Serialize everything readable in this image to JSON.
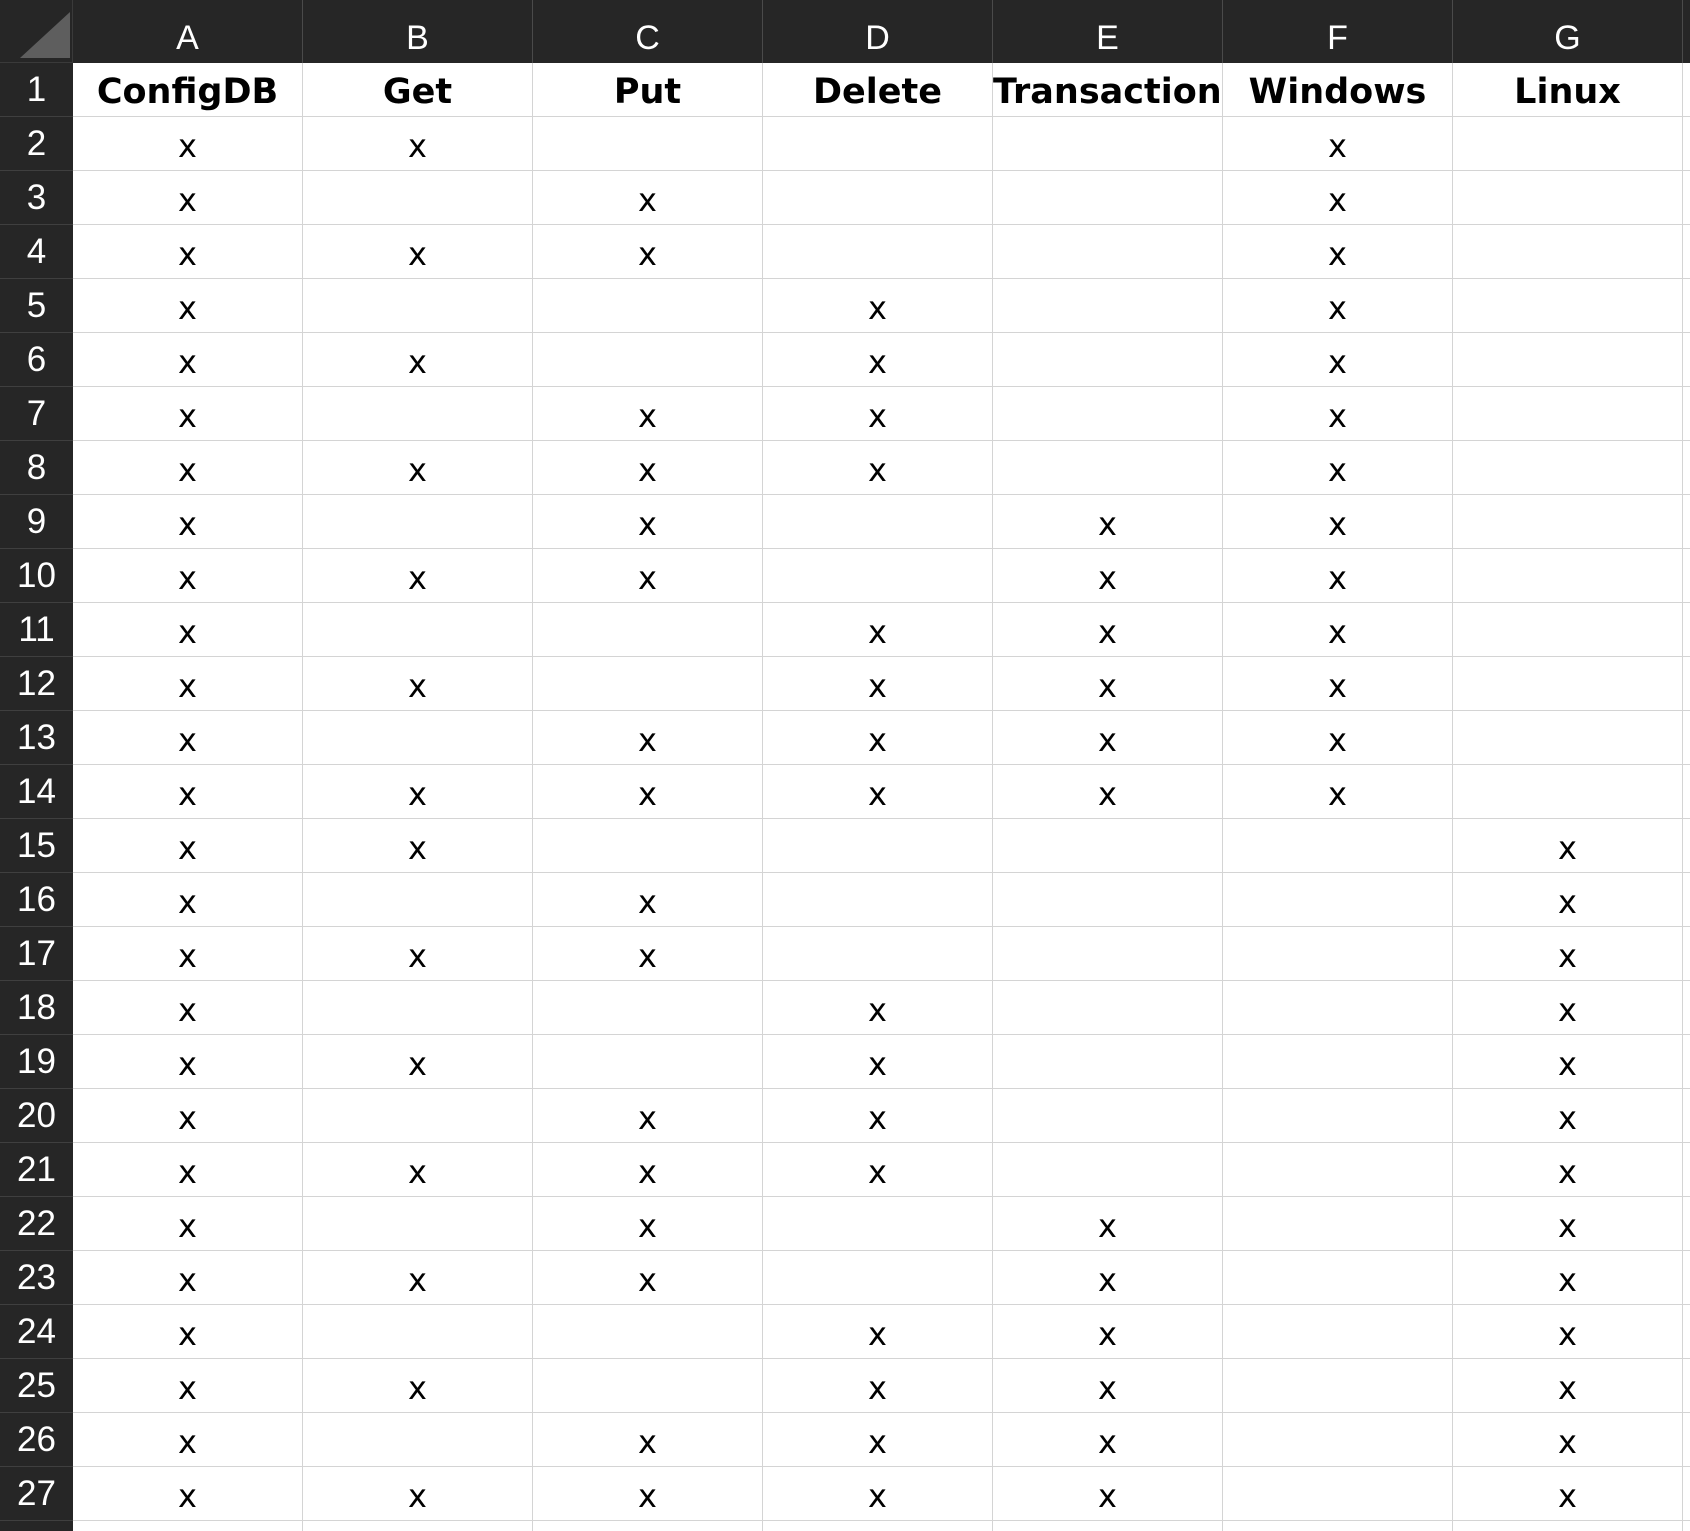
{
  "spreadsheet": {
    "column_letters": [
      "A",
      "B",
      "C",
      "D",
      "E",
      "F",
      "G"
    ],
    "row_numbers": [
      "1",
      "2",
      "3",
      "4",
      "5",
      "6",
      "7",
      "8",
      "9",
      "10",
      "11",
      "12",
      "13",
      "14",
      "15",
      "16",
      "17",
      "18",
      "19",
      "20",
      "21",
      "22",
      "23",
      "24",
      "25",
      "26",
      "27"
    ],
    "header_row": [
      "ConfigDB",
      "Get",
      "Put",
      "Delete",
      "Transactions",
      "Windows",
      "Linux"
    ],
    "rows": [
      [
        "x",
        "x",
        "",
        "",
        "",
        "x",
        ""
      ],
      [
        "x",
        "",
        "x",
        "",
        "",
        "x",
        ""
      ],
      [
        "x",
        "x",
        "x",
        "",
        "",
        "x",
        ""
      ],
      [
        "x",
        "",
        "",
        "x",
        "",
        "x",
        ""
      ],
      [
        "x",
        "x",
        "",
        "x",
        "",
        "x",
        ""
      ],
      [
        "x",
        "",
        "x",
        "x",
        "",
        "x",
        ""
      ],
      [
        "x",
        "x",
        "x",
        "x",
        "",
        "x",
        ""
      ],
      [
        "x",
        "",
        "x",
        "",
        "x",
        "x",
        ""
      ],
      [
        "x",
        "x",
        "x",
        "",
        "x",
        "x",
        ""
      ],
      [
        "x",
        "",
        "",
        "x",
        "x",
        "x",
        ""
      ],
      [
        "x",
        "x",
        "",
        "x",
        "x",
        "x",
        ""
      ],
      [
        "x",
        "",
        "x",
        "x",
        "x",
        "x",
        ""
      ],
      [
        "x",
        "x",
        "x",
        "x",
        "x",
        "x",
        ""
      ],
      [
        "x",
        "x",
        "",
        "",
        "",
        "",
        "x"
      ],
      [
        "x",
        "",
        "x",
        "",
        "",
        "",
        "x"
      ],
      [
        "x",
        "x",
        "x",
        "",
        "",
        "",
        "x"
      ],
      [
        "x",
        "",
        "",
        "x",
        "",
        "",
        "x"
      ],
      [
        "x",
        "x",
        "",
        "x",
        "",
        "",
        "x"
      ],
      [
        "x",
        "",
        "x",
        "x",
        "",
        "",
        "x"
      ],
      [
        "x",
        "x",
        "x",
        "x",
        "",
        "",
        "x"
      ],
      [
        "x",
        "",
        "x",
        "",
        "x",
        "",
        "x"
      ],
      [
        "x",
        "x",
        "x",
        "",
        "x",
        "",
        "x"
      ],
      [
        "x",
        "",
        "",
        "x",
        "x",
        "",
        "x"
      ],
      [
        "x",
        "x",
        "",
        "x",
        "x",
        "",
        "x"
      ],
      [
        "x",
        "",
        "x",
        "x",
        "x",
        "",
        "x"
      ],
      [
        "x",
        "x",
        "x",
        "x",
        "x",
        "",
        "x"
      ]
    ]
  }
}
